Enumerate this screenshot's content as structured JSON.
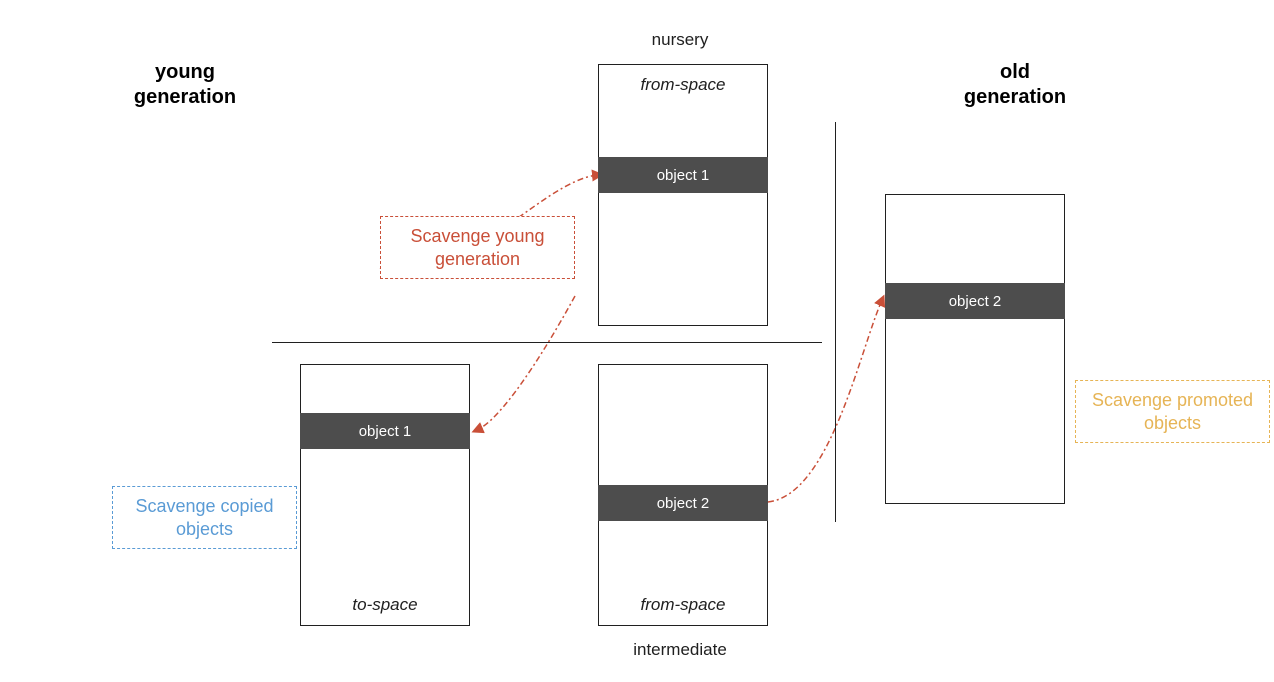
{
  "headings": {
    "young": "young\ngeneration",
    "old": "old\ngeneration"
  },
  "outside_labels": {
    "nursery": "nursery",
    "intermediate": "intermediate"
  },
  "boxes": {
    "nursery": {
      "space_label": "from-space",
      "obj": "object 1"
    },
    "to_space": {
      "space_label": "to-space",
      "obj": "object 1"
    },
    "intermediate": {
      "space_label": "from-space",
      "obj": "object 2"
    },
    "old": {
      "obj": "object 2"
    }
  },
  "callouts": {
    "scav_young": "Scavenge young\ngeneration",
    "scav_copied": "Scavenge copied\nobjects",
    "scav_promoted": "Scavenge promoted\nobjects"
  },
  "colors": {
    "red": "#c94f38",
    "blue": "#5a9bd5",
    "gold": "#e6b455",
    "bar": "#4d4d4d"
  }
}
